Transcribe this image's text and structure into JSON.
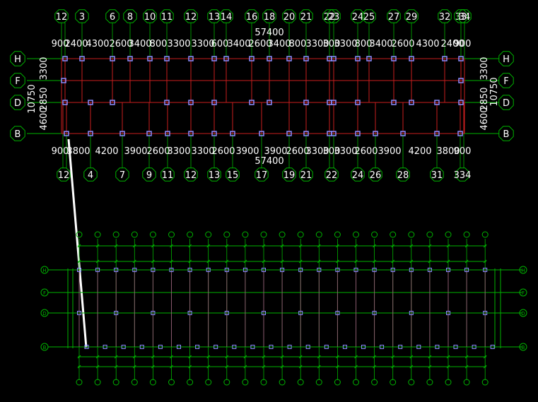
{
  "colors": {
    "background": "#000000",
    "grid": "#00b400",
    "beam": "#c81e1e",
    "column": "#8c8cff",
    "text": "#ffffff",
    "secondary_beam": "#8a5a6e",
    "leader": "#ffffff"
  },
  "top_plan": {
    "overall_dimension": "57400",
    "axes_top": [
      "1",
      "2",
      "3",
      "6",
      "8",
      "10",
      "11",
      "12",
      "13",
      "14",
      "16",
      "18",
      "20",
      "21",
      "22",
      "23",
      "24",
      "25",
      "27",
      "29",
      "32",
      "33",
      "34"
    ],
    "axes_bottom": [
      "1",
      "2",
      "4",
      "7",
      "9",
      "11",
      "12",
      "13",
      "15",
      "17",
      "19",
      "21",
      "22",
      "23",
      "24",
      "26",
      "28",
      "31",
      "33",
      "34"
    ],
    "top_spacings": [
      "900",
      "2400",
      "4300",
      "2600",
      "3400",
      "800",
      "3300",
      "3300",
      "600",
      "3400",
      "2600",
      "3400",
      "800",
      "3300",
      "300",
      "3300",
      "800",
      "3400",
      "2600",
      "4300",
      "2400",
      "900"
    ],
    "bottom_spacings": [
      "900",
      "3800",
      "4200",
      "3900",
      "2600",
      "3300",
      "3300",
      "2600",
      "3900",
      "3900",
      "2600",
      "3300",
      "300",
      "3300",
      "2600",
      "3900",
      "4200",
      "3800",
      "900"
    ],
    "row_labels": [
      "H",
      "F",
      "D",
      "B"
    ],
    "left_dims": {
      "total": "10750",
      "upper": "3300",
      "middle": "2850",
      "lower": "4600"
    },
    "right_dims": {
      "total": "10750",
      "upper": "3300",
      "middle": "2850",
      "lower": "4600"
    }
  },
  "bottom_plan": {
    "row_labels": [
      "H",
      "F",
      "D",
      "B"
    ]
  }
}
